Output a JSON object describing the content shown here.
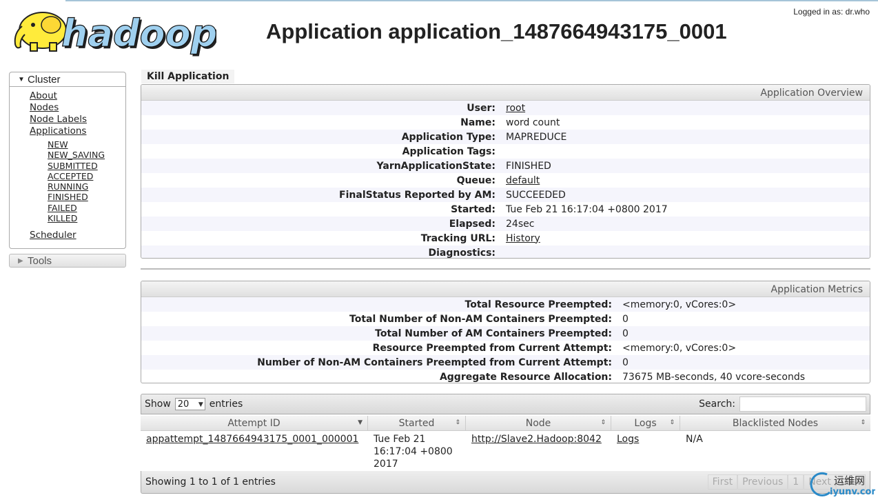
{
  "header": {
    "logo_text": "hadoop",
    "logged_in": "Logged in as: dr.who",
    "title": "Application application_1487664943175_0001"
  },
  "sidebar": {
    "cluster_label": "Cluster",
    "links": [
      "About",
      "Nodes",
      "Node Labels",
      "Applications"
    ],
    "app_states": [
      "NEW",
      "NEW_SAVING",
      "SUBMITTED",
      "ACCEPTED",
      "RUNNING",
      "FINISHED",
      "FAILED",
      "KILLED"
    ],
    "scheduler": "Scheduler",
    "tools_label": "Tools"
  },
  "kill_label": "Kill Application",
  "overview": {
    "title": "Application Overview",
    "rows": [
      {
        "key": "User:",
        "value": "root"
      },
      {
        "key": "Name:",
        "value": "word count"
      },
      {
        "key": "Application Type:",
        "value": "MAPREDUCE"
      },
      {
        "key": "Application Tags:",
        "value": ""
      },
      {
        "key": "YarnApplicationState:",
        "value": "FINISHED"
      },
      {
        "key": "Queue:",
        "value": "default"
      },
      {
        "key": "FinalStatus Reported by AM:",
        "value": "SUCCEEDED"
      },
      {
        "key": "Started:",
        "value": "Tue Feb 21 16:17:04 +0800 2017"
      },
      {
        "key": "Elapsed:",
        "value": "24sec"
      },
      {
        "key": "Tracking URL:",
        "value": "History"
      },
      {
        "key": "Diagnostics:",
        "value": ""
      }
    ]
  },
  "metrics": {
    "title": "Application Metrics",
    "rows": [
      {
        "key": "Total Resource Preempted:",
        "value": "<memory:0, vCores:0>"
      },
      {
        "key": "Total Number of Non-AM Containers Preempted:",
        "value": "0"
      },
      {
        "key": "Total Number of AM Containers Preempted:",
        "value": "0"
      },
      {
        "key": "Resource Preempted from Current Attempt:",
        "value": "<memory:0, vCores:0>"
      },
      {
        "key": "Number of Non-AM Containers Preempted from Current Attempt:",
        "value": "0"
      },
      {
        "key": "Aggregate Resource Allocation:",
        "value": "73675 MB-seconds, 40 vcore-seconds"
      }
    ]
  },
  "attempts": {
    "show_label": "Show",
    "page_size": "20",
    "entries_label": "entries",
    "search_label": "Search:",
    "columns": [
      "Attempt ID",
      "Started",
      "Node",
      "Logs",
      "Blacklisted Nodes"
    ],
    "rows": [
      {
        "attempt_id": "appattempt_1487664943175_0001_000001",
        "started": "Tue Feb 21 16:17:04 +0800 2017",
        "node": "http://Slave2.Hadoop:8042",
        "logs": "Logs",
        "blacklisted": "N/A"
      }
    ],
    "info": "Showing 1 to 1 of 1 entries",
    "pager": [
      "First",
      "Previous",
      "1",
      "Next",
      "Last"
    ]
  },
  "watermark": {
    "top_text": "运维网",
    "bottom_text": "iyunv.com"
  }
}
